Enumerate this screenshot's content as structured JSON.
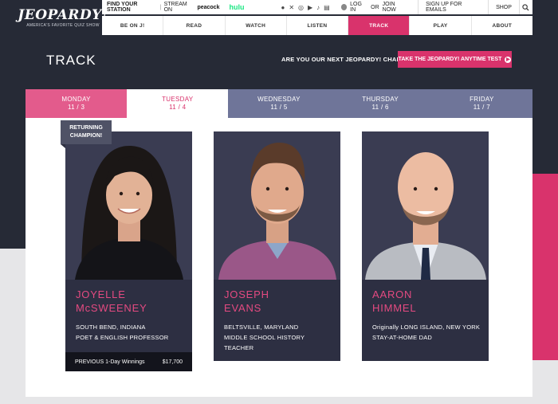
{
  "brand": {
    "logo": "JEOPARDY!",
    "tagline": "AMERICA'S FAVORITE QUIZ SHOW"
  },
  "topbar": {
    "find_station": "FIND YOUR STATION",
    "stream_on": "STREAM ON",
    "peacock": "peacock",
    "hulu": "hulu",
    "social_icons": [
      "facebook-icon",
      "x-icon",
      "instagram-icon",
      "youtube-icon",
      "tiktok-icon",
      "news-icon"
    ],
    "login": "LOG IN",
    "or": "OR",
    "join": "JOIN NOW",
    "signup": "SIGN UP FOR EMAILS",
    "shop": "SHOP"
  },
  "nav": [
    {
      "label": "BE ON J!"
    },
    {
      "label": "READ"
    },
    {
      "label": "WATCH"
    },
    {
      "label": "LISTEN"
    },
    {
      "label": "TRACK"
    },
    {
      "label": "PLAY"
    },
    {
      "label": "ABOUT"
    }
  ],
  "page": {
    "title": "TRACK",
    "cta_text": "ARE YOU OUR NEXT JEOPARDY! CHAMPION?",
    "cta_button": "TAKE THE JEOPARDY! ANYTIME TEST"
  },
  "days": [
    {
      "day": "MONDAY",
      "date": "11 / 3"
    },
    {
      "day": "TUESDAY",
      "date": "11 / 4"
    },
    {
      "day": "WEDNESDAY",
      "date": "11 / 5"
    },
    {
      "day": "THURSDAY",
      "date": "11 / 6"
    },
    {
      "day": "FRIDAY",
      "date": "11 / 7"
    }
  ],
  "badge": {
    "line1": "RETURNING",
    "line2": "CHAMPION!"
  },
  "contestants": [
    {
      "first": "JOYELLE",
      "last": "McSWEENEY",
      "location": "SOUTH BEND, INDIANA",
      "occupation": "POET & ENGLISH PROFESSOR",
      "winnings_label": "PREVIOUS 1-Day Winnings",
      "winnings_value": "$17,700"
    },
    {
      "first": "JOSEPH",
      "last": "EVANS",
      "location": "BELTSVILLE, MARYLAND",
      "occupation": "MIDDLE SCHOOL HISTORY TEACHER"
    },
    {
      "first": "AARON",
      "last": "HIMMEL",
      "location": "Originally LONG ISLAND, NEW YORK",
      "occupation": "STAY-AT-HOME DAD"
    }
  ],
  "colors": {
    "accent": "#d9336c",
    "dark": "#262a36",
    "card": "#2d2f42",
    "tab_inactive": "#6f7599"
  }
}
